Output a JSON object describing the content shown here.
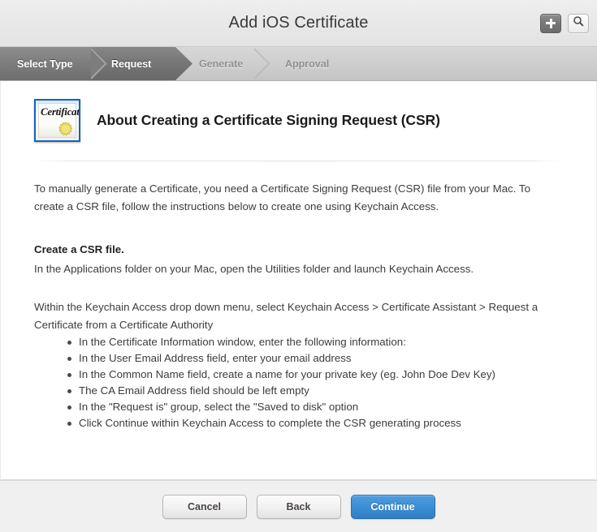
{
  "titlebar": {
    "title": "Add iOS Certificate",
    "add_button_icon": "plus-icon",
    "search_button_icon": "search-icon"
  },
  "steps": [
    {
      "label": "Select Type",
      "state": "done"
    },
    {
      "label": "Request",
      "state": "current"
    },
    {
      "label": "Generate",
      "state": "todo"
    },
    {
      "label": "Approval",
      "state": "todo"
    }
  ],
  "hero": {
    "icon_name": "certificate-icon",
    "icon_caption": "Certificate",
    "heading": "About Creating a Certificate Signing Request (CSR)"
  },
  "content": {
    "intro": "To manually generate a Certificate, you need a Certificate Signing Request (CSR) file from your Mac. To create a CSR file, follow the instructions below to create one using Keychain Access.",
    "section_heading": "Create a CSR file.",
    "section_para": "In the Applications folder on your Mac, open the Utilities folder and launch Keychain Access.",
    "menu_para": "Within the Keychain Access drop down menu, select Keychain Access > Certificate Assistant > Request a Certificate from a Certificate Authority",
    "bullets": [
      "In the Certificate Information window, enter the following information:",
      "In the User Email Address field, enter your email address",
      "In the Common Name field, create a name for your private key (eg. John Doe Dev Key)",
      "The CA Email Address field should be left empty",
      "In the \"Request is\" group, select the \"Saved to disk\" option",
      "Click Continue within Keychain Access to complete the CSR generating process"
    ]
  },
  "footer": {
    "cancel_label": "Cancel",
    "back_label": "Back",
    "continue_label": "Continue"
  },
  "colors": {
    "primary_button": "#3d8fd6",
    "step_active": "#777777",
    "step_inactive_text": "#909090",
    "cert_icon_border": "#1a63b8",
    "cert_seal": "#e6d24a"
  }
}
